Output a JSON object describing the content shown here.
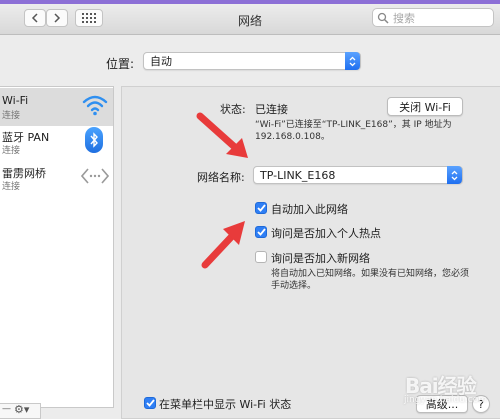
{
  "window": {
    "title": "网络"
  },
  "search": {
    "placeholder": "搜索"
  },
  "location": {
    "label": "位置:",
    "value": "自动"
  },
  "sidebar": {
    "items": [
      {
        "name": "Wi-Fi",
        "status": "连接"
      },
      {
        "name": "蓝牙 PAN",
        "status": "连接"
      },
      {
        "name": "雷雳网桥",
        "status": "连接"
      }
    ]
  },
  "status": {
    "label": "状态:",
    "value": "已连接",
    "button": "关闭 Wi-Fi",
    "description_line1": "“Wi-Fi”已连接至“TP-LINK_E168”，其 IP 地址为",
    "description_line2": "192.168.0.108。"
  },
  "network_name": {
    "label": "网络名称:",
    "value": "TP-LINK_E168"
  },
  "options": {
    "auto_join": "自动加入此网络",
    "ask_hotspot": "询问是否加入个人热点",
    "ask_new": "询问是否加入新网络",
    "hint_line1": "将自动加入已知网络。如果没有已知网络，您必须",
    "hint_line2": "手动选择。"
  },
  "footer": {
    "show_menubar": "在菜单栏中显示 Wi-Fi 状态",
    "advanced": "高级...",
    "help": "?"
  },
  "watermark": {
    "brand": "Bai经验",
    "url": "jingyan.baidu.com"
  },
  "colors": {
    "accent": "#2f7ff5",
    "arrow": "#e83b3b",
    "topbar": "#8c6fd6"
  }
}
